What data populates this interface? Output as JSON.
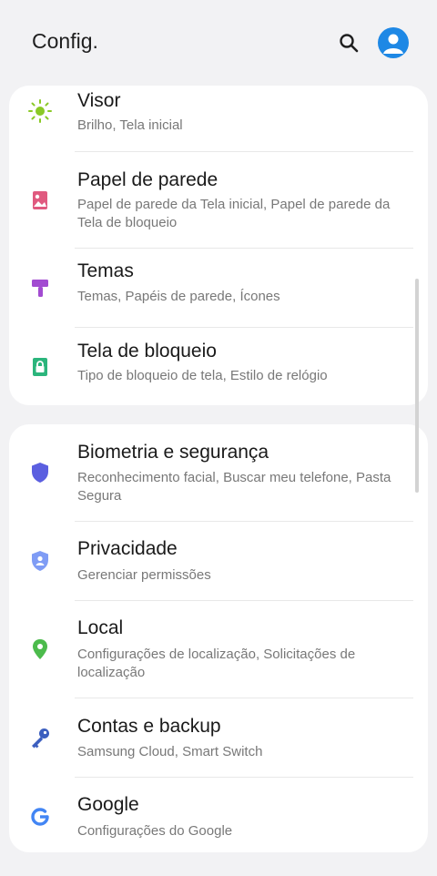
{
  "header": {
    "title": "Config.",
    "search_icon": "search-icon",
    "profile_icon": "profile-avatar-icon"
  },
  "sections": [
    {
      "items": [
        {
          "title": "Visor",
          "subtitle": "Brilho, Tela inicial",
          "icon": "sun-icon",
          "color": "#8ac926"
        },
        {
          "title": "Papel de parede",
          "subtitle": "Papel de parede da Tela inicial, Papel de parede da Tela de bloqueio",
          "icon": "image-icon",
          "color": "#e05a7f"
        },
        {
          "title": "Temas",
          "subtitle": "Temas, Papéis de parede, Ícones",
          "icon": "paintbrush-icon",
          "color": "#a24bd1"
        },
        {
          "title": "Tela de bloqueio",
          "subtitle": "Tipo de bloqueio de tela, Estilo de relógio",
          "icon": "lock-icon",
          "color": "#2bb57c"
        }
      ]
    },
    {
      "items": [
        {
          "title": "Biometria e segurança",
          "subtitle": "Reconhecimento facial, Buscar meu telefone, Pasta Segura",
          "icon": "shield-icon",
          "color": "#5b5fe0"
        },
        {
          "title": "Privacidade",
          "subtitle": "Gerenciar permissões",
          "icon": "privacy-shield-icon",
          "color": "#7f9cf5"
        },
        {
          "title": "Local",
          "subtitle": "Configurações de localização, Solicitações de localização",
          "icon": "location-pin-icon",
          "color": "#4cbb4c"
        },
        {
          "title": "Contas e backup",
          "subtitle": "Samsung Cloud, Smart Switch",
          "icon": "key-icon",
          "color": "#3c5fbf"
        },
        {
          "title": "Google",
          "subtitle": "Configurações do Google",
          "icon": "google-icon",
          "color": "#4285f4"
        }
      ]
    }
  ]
}
